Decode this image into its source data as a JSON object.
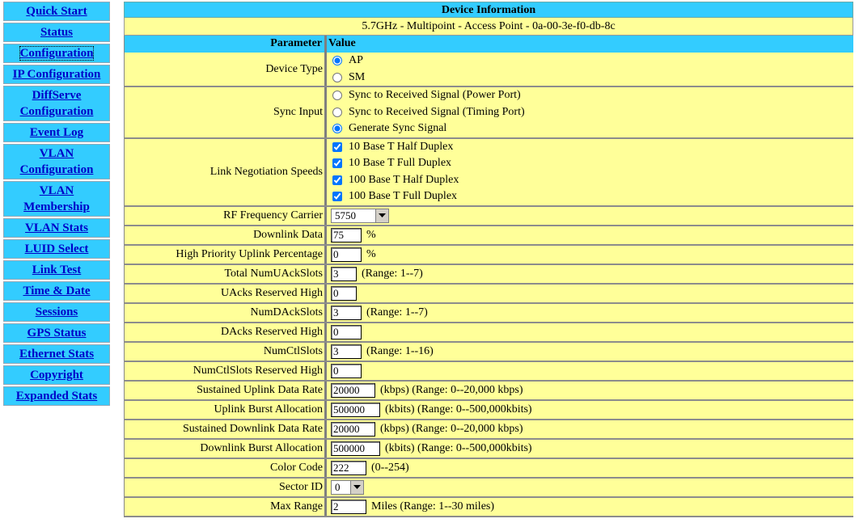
{
  "nav": [
    {
      "label": "Quick Start"
    },
    {
      "label": "Status"
    },
    {
      "label": "Configuration",
      "active": true
    },
    {
      "label": "IP Configuration"
    },
    {
      "label": "DiffServe Configuration",
      "lines": [
        "DiffServe",
        "Configuration"
      ]
    },
    {
      "label": "Event Log"
    },
    {
      "label": "VLAN Configuration",
      "lines": [
        "VLAN",
        "Configuration"
      ]
    },
    {
      "label": "VLAN Membership",
      "lines": [
        "VLAN",
        "Membership"
      ]
    },
    {
      "label": "VLAN Stats"
    },
    {
      "label": "LUID Select"
    },
    {
      "label": "Link Test"
    },
    {
      "label": "Time & Date"
    },
    {
      "label": "Sessions"
    },
    {
      "label": "GPS Status"
    },
    {
      "label": "Ethernet Stats"
    },
    {
      "label": "Copyright"
    },
    {
      "label": "Expanded Stats"
    }
  ],
  "device": {
    "title": "Device Information",
    "subtitle": "5.7GHz - Multipoint - Access Point - 0a-00-3e-f0-db-8c"
  },
  "table": {
    "param_header": "Parameter",
    "value_header": "Value",
    "device_type": {
      "label": "Device Type",
      "options": [
        "AP",
        "SM"
      ],
      "selected": 0
    },
    "sync_input": {
      "label": "Sync Input",
      "options": [
        "Sync to Received Signal (Power Port)",
        "Sync to Received Signal (Timing Port)",
        "Generate Sync Signal"
      ],
      "selected": 2
    },
    "link_speeds": {
      "label": "Link Negotiation Speeds",
      "options": [
        "10 Base T Half Duplex",
        "10 Base T Full Duplex",
        "100 Base T Half Duplex",
        "100 Base T Full Duplex"
      ],
      "checked": [
        true,
        true,
        true,
        true
      ]
    },
    "rf_carrier": {
      "label": "RF Frequency Carrier",
      "value": "5750"
    },
    "downlink_data": {
      "label": "Downlink Data",
      "value": "75",
      "suffix": "%"
    },
    "hp_uplink": {
      "label": "High Priority Uplink Percentage",
      "value": "0",
      "suffix": "%"
    },
    "total_uack": {
      "label": "Total NumUAckSlots",
      "value": "3",
      "suffix": "(Range: 1--7)"
    },
    "uacks_high": {
      "label": "UAcks Reserved High",
      "value": "0",
      "suffix": ""
    },
    "numdack": {
      "label": "NumDAckSlots",
      "value": "3",
      "suffix": "(Range: 1--7)"
    },
    "dacks_high": {
      "label": "DAcks Reserved High",
      "value": "0",
      "suffix": ""
    },
    "numctl": {
      "label": "NumCtlSlots",
      "value": "3",
      "suffix": "(Range: 1--16)"
    },
    "numctl_high": {
      "label": "NumCtlSlots Reserved High",
      "value": "0",
      "suffix": ""
    },
    "sus_uplink": {
      "label": "Sustained Uplink Data Rate",
      "value": "20000",
      "suffix": "(kbps) (Range: 0--20,000 kbps)"
    },
    "uplink_burst": {
      "label": "Uplink Burst Allocation",
      "value": "500000",
      "suffix": "(kbits) (Range: 0--500,000kbits)"
    },
    "sus_downlink": {
      "label": "Sustained Downlink Data Rate",
      "value": "20000",
      "suffix": "(kbps) (Range: 0--20,000 kbps)"
    },
    "downlink_burst": {
      "label": "Downlink Burst Allocation",
      "value": "500000",
      "suffix": "(kbits) (Range: 0--500,000kbits)"
    },
    "color_code": {
      "label": "Color Code",
      "value": "222",
      "suffix": "(0--254)"
    },
    "sector_id": {
      "label": "Sector ID",
      "value": "0"
    },
    "max_range": {
      "label": "Max Range",
      "value": "2",
      "suffix": "Miles (Range: 1--30 miles)"
    }
  }
}
